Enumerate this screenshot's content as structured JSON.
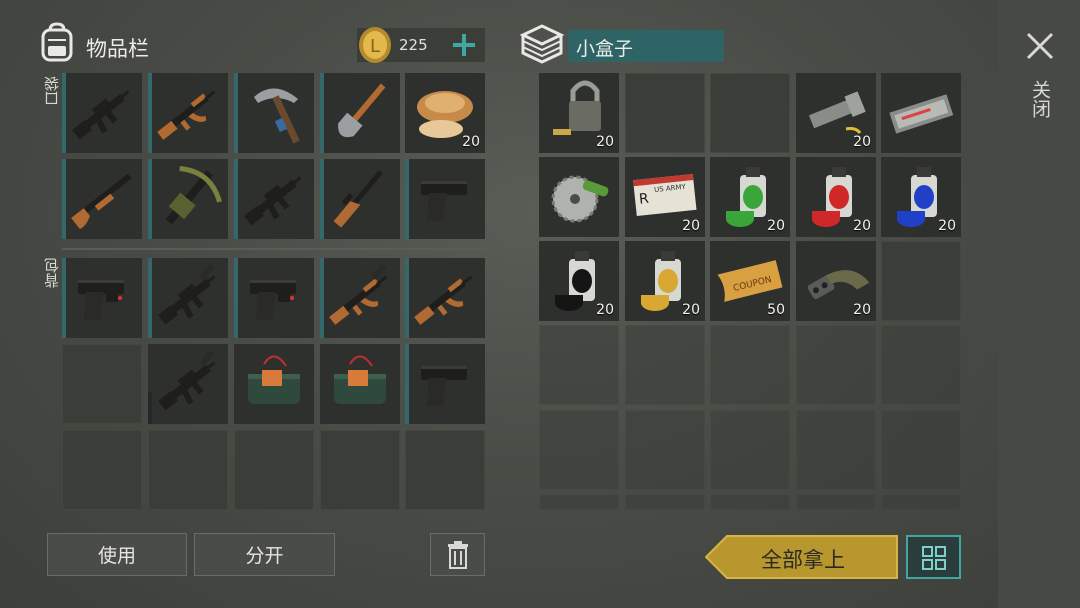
{
  "inventory": {
    "title": "物品栏",
    "coins": "225",
    "pocket_label": "口袋",
    "backpack_label": "背包",
    "pocket_slots": [
      {
        "icon": "assault-rifle-icon",
        "count": "",
        "bar": "teal"
      },
      {
        "icon": "ak-rifle-icon",
        "count": "",
        "bar": "teal"
      },
      {
        "icon": "pickaxe-icon",
        "count": "",
        "bar": "teal"
      },
      {
        "icon": "shovel-icon",
        "count": "",
        "bar": "teal"
      },
      {
        "icon": "mushroom-icon",
        "count": "20",
        "bar": ""
      },
      {
        "icon": "shotgun-icon",
        "count": "",
        "bar": "teal"
      },
      {
        "icon": "crossbow-icon",
        "count": "",
        "bar": "teal"
      },
      {
        "icon": "assault-rifle-icon",
        "count": "",
        "bar": "teal"
      },
      {
        "icon": "sniper-rifle-icon",
        "count": "",
        "bar": "teal"
      },
      {
        "icon": "pistol-icon",
        "count": "",
        "bar": "teal"
      }
    ],
    "backpack_slots": [
      {
        "icon": "pistol-laser-icon",
        "count": "",
        "bar": "teal"
      },
      {
        "icon": "suppressed-rifle-icon",
        "count": "",
        "bar": "teal"
      },
      {
        "icon": "pistol-laser-icon",
        "count": "",
        "bar": "teal"
      },
      {
        "icon": "ak-suppressed-icon",
        "count": "",
        "bar": "teal"
      },
      {
        "icon": "ak-rifle-icon",
        "count": "",
        "bar": "teal"
      },
      {
        "icon": "",
        "count": "",
        "bar": ""
      },
      {
        "icon": "suppressed-rifle-icon",
        "count": "",
        "bar": "dark"
      },
      {
        "icon": "explosive-icon",
        "count": "",
        "bar": ""
      },
      {
        "icon": "explosive-icon",
        "count": "",
        "bar": ""
      },
      {
        "icon": "pistol-icon",
        "count": "",
        "bar": "teal"
      }
    ],
    "use_label": "使用",
    "split_label": "分开"
  },
  "container": {
    "title": "小盒子",
    "slots": [
      {
        "icon": "padlock-icon",
        "count": "20"
      },
      {
        "icon": "",
        "count": ""
      },
      {
        "icon": "",
        "count": ""
      },
      {
        "icon": "flashlight-icon",
        "count": "20"
      },
      {
        "icon": "circuit-board-icon",
        "count": ""
      },
      {
        "icon": "saw-blade-icon",
        "count": ""
      },
      {
        "icon": "army-id-card-icon",
        "count": "20",
        "text": "US ARMY"
      },
      {
        "icon": "spray-paint-green-icon",
        "count": "20"
      },
      {
        "icon": "spray-paint-red-icon",
        "count": "20"
      },
      {
        "icon": "spray-paint-blue-icon",
        "count": "20"
      },
      {
        "icon": "spray-paint-black-icon",
        "count": "20"
      },
      {
        "icon": "spray-paint-yellow-icon",
        "count": "20"
      },
      {
        "icon": "coupon-icon",
        "count": "50",
        "text": "COUPON"
      },
      {
        "icon": "rifle-magazine-icon",
        "count": "20"
      },
      {
        "icon": "",
        "count": ""
      }
    ],
    "take_all_label": "全部拿上"
  },
  "close_label": "关闭",
  "colors": {
    "teal": "#35686a",
    "gold": "#b8972e",
    "accent": "#3ea8a0"
  }
}
